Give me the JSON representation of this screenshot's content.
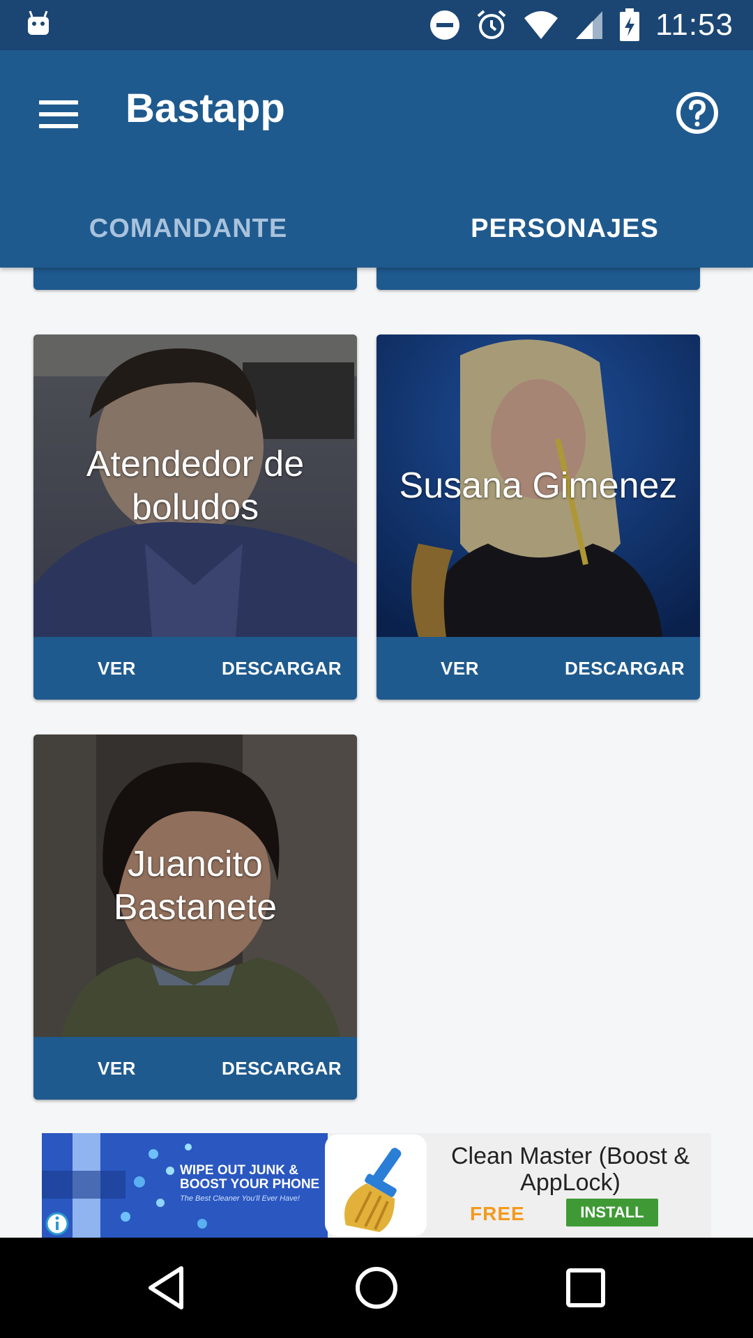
{
  "status_bar": {
    "time": "11:53",
    "icons": [
      "android-icon",
      "do-not-disturb-icon",
      "alarm-icon",
      "wifi-icon",
      "signal-icon",
      "battery-charging-icon"
    ]
  },
  "app_bar": {
    "title": "Bastapp",
    "menu_icon": "hamburger-menu-icon",
    "help_icon": "help-circle-icon",
    "color": "#1f5a8e"
  },
  "tabs": [
    {
      "label": "COMANDANTE",
      "active": false
    },
    {
      "label": "PERSONAJES",
      "active": true
    }
  ],
  "cards": [
    {
      "name": "Atendedor de boludos",
      "view_label": "VER",
      "download_label": "DESCARGAR"
    },
    {
      "name": "Susana Gimenez",
      "view_label": "VER",
      "download_label": "DESCARGAR"
    },
    {
      "name": "Juancito Bastanete",
      "view_label": "VER",
      "download_label": "DESCARGAR"
    }
  ],
  "ad": {
    "promo_headline_1": "WIPE OUT JUNK &",
    "promo_headline_2": "BOOST YOUR PHONE",
    "promo_subline": "The Best Cleaner You'll Ever Have!",
    "title": "Clean Master (Boost & AppLock)",
    "price": "FREE",
    "install_label": "INSTALL"
  },
  "nav_bar": {
    "icons": [
      "back-icon",
      "home-icon",
      "recents-icon"
    ]
  }
}
